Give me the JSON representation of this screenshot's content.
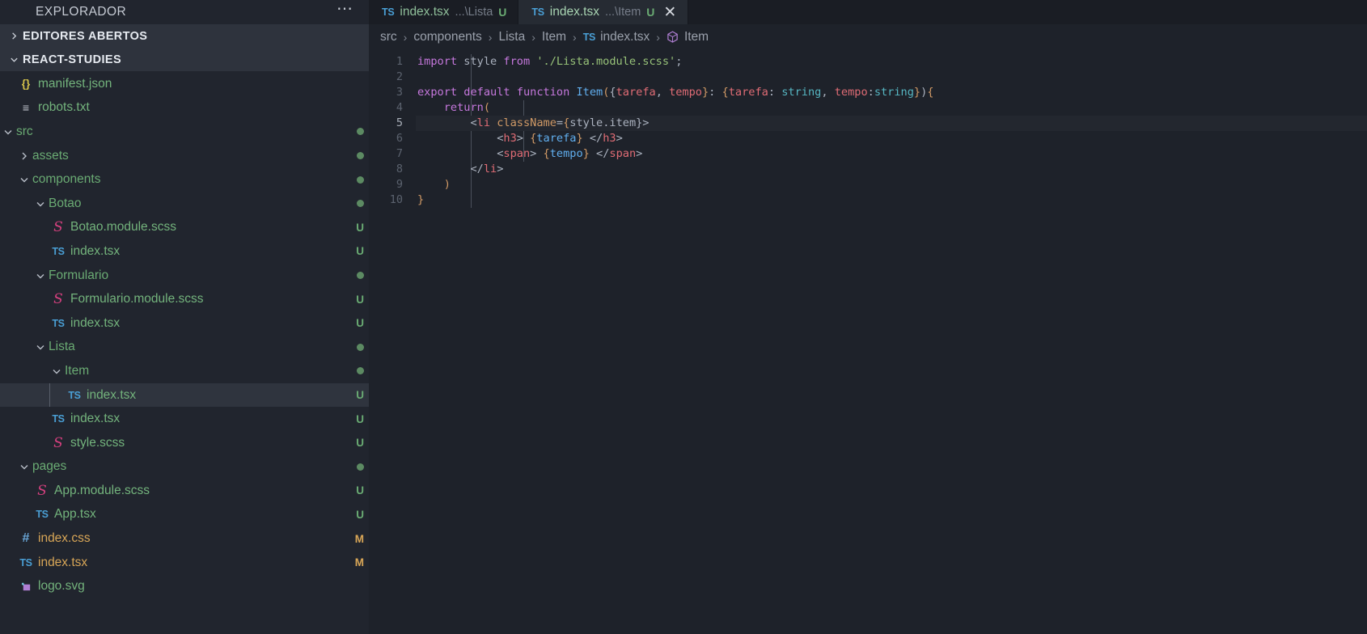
{
  "sidebar": {
    "title": "EXPLORADOR",
    "more_icon": "ellipsis-icon",
    "sections": [
      {
        "label": "EDITORES ABERTOS",
        "expanded": false
      },
      {
        "label": "REACT-STUDIES",
        "expanded": true
      }
    ],
    "tree": [
      {
        "name": "manifest.json",
        "icon": "json-icon",
        "depth": 1,
        "kind": "file",
        "badge": ""
      },
      {
        "name": "robots.txt",
        "icon": "txt-icon",
        "depth": 1,
        "kind": "file",
        "badge": ""
      },
      {
        "name": "src",
        "icon": "folder-icon",
        "depth": 0,
        "kind": "folder",
        "expanded": true,
        "badge": "dot"
      },
      {
        "name": "assets",
        "icon": "folder-icon",
        "depth": 1,
        "kind": "folder",
        "expanded": false,
        "badge": "dot"
      },
      {
        "name": "components",
        "icon": "folder-icon",
        "depth": 1,
        "kind": "folder",
        "expanded": true,
        "badge": "dot"
      },
      {
        "name": "Botao",
        "icon": "folder-icon",
        "depth": 2,
        "kind": "folder",
        "expanded": true,
        "badge": "dot"
      },
      {
        "name": "Botao.module.scss",
        "icon": "scss-icon",
        "depth": 3,
        "kind": "file",
        "badge": "U"
      },
      {
        "name": "index.tsx",
        "icon": "ts-icon",
        "depth": 3,
        "kind": "file",
        "badge": "U"
      },
      {
        "name": "Formulario",
        "icon": "folder-icon",
        "depth": 2,
        "kind": "folder",
        "expanded": true,
        "badge": "dot"
      },
      {
        "name": "Formulario.module.scss",
        "icon": "scss-icon",
        "depth": 3,
        "kind": "file",
        "badge": "U"
      },
      {
        "name": "index.tsx",
        "icon": "ts-icon",
        "depth": 3,
        "kind": "file",
        "badge": "U"
      },
      {
        "name": "Lista",
        "icon": "folder-icon",
        "depth": 2,
        "kind": "folder",
        "expanded": true,
        "badge": "dot"
      },
      {
        "name": "Item",
        "icon": "folder-icon",
        "depth": 3,
        "kind": "folder",
        "expanded": true,
        "badge": "dot"
      },
      {
        "name": "index.tsx",
        "icon": "ts-icon",
        "depth": 4,
        "kind": "file",
        "badge": "U",
        "selected": true
      },
      {
        "name": "index.tsx",
        "icon": "ts-icon",
        "depth": 3,
        "kind": "file",
        "badge": "U"
      },
      {
        "name": "style.scss",
        "icon": "scss-icon",
        "depth": 3,
        "kind": "file",
        "badge": "U"
      },
      {
        "name": "pages",
        "icon": "folder-icon",
        "depth": 1,
        "kind": "folder",
        "expanded": true,
        "badge": "dot"
      },
      {
        "name": "App.module.scss",
        "icon": "scss-icon",
        "depth": 2,
        "kind": "file",
        "badge": "U"
      },
      {
        "name": "App.tsx",
        "icon": "ts-icon",
        "depth": 2,
        "kind": "file",
        "badge": "U"
      },
      {
        "name": "index.css",
        "icon": "css-icon",
        "depth": 1,
        "kind": "file",
        "badge": "M",
        "modified": true
      },
      {
        "name": "index.tsx",
        "icon": "ts-icon",
        "depth": 1,
        "kind": "file",
        "badge": "M",
        "modified": true
      },
      {
        "name": "logo.svg",
        "icon": "svg-icon",
        "depth": 1,
        "kind": "file",
        "badge": ""
      }
    ]
  },
  "tabs": [
    {
      "icon": "ts-icon",
      "name": "index.tsx",
      "path": "...\\Lista",
      "dirty": "U",
      "active": false,
      "close": ""
    },
    {
      "icon": "ts-icon",
      "name": "index.tsx",
      "path": "...\\Item",
      "dirty": "U",
      "active": true,
      "close": "✕"
    }
  ],
  "breadcrumb": {
    "separator": "›",
    "items": [
      {
        "label": "src",
        "icon": ""
      },
      {
        "label": "components",
        "icon": ""
      },
      {
        "label": "Lista",
        "icon": ""
      },
      {
        "label": "Item",
        "icon": ""
      },
      {
        "label": "index.tsx",
        "icon": "ts-icon"
      },
      {
        "label": "Item",
        "icon": "symbol-class-icon"
      }
    ]
  },
  "code": {
    "line_numbers": [
      "1",
      "2",
      "3",
      "4",
      "5",
      "6",
      "7",
      "8",
      "9",
      "10"
    ],
    "current_line": 5,
    "lines": [
      "import style from './Lista.module.scss';",
      "",
      "export default function Item({tarefa, tempo}: {tarefa: string, tempo:string}){",
      "    return(",
      "        <li className={style.item}>",
      "            <h3> {tarefa} </h3>",
      "            <span> {tempo} </span>",
      "        </li>",
      "    )",
      "}"
    ]
  },
  "colors": {
    "sidebar_bg": "#21252e",
    "editor_bg": "#1e222a",
    "tabbar_bg": "#1a1d24",
    "active_tab_bg": "#262b33",
    "selection_bg": "#2f343e",
    "accent_green": "#6aab73",
    "accent_orange": "#d8a657",
    "ts_blue": "#4a9fd5",
    "scss_pink": "#d6407f"
  }
}
